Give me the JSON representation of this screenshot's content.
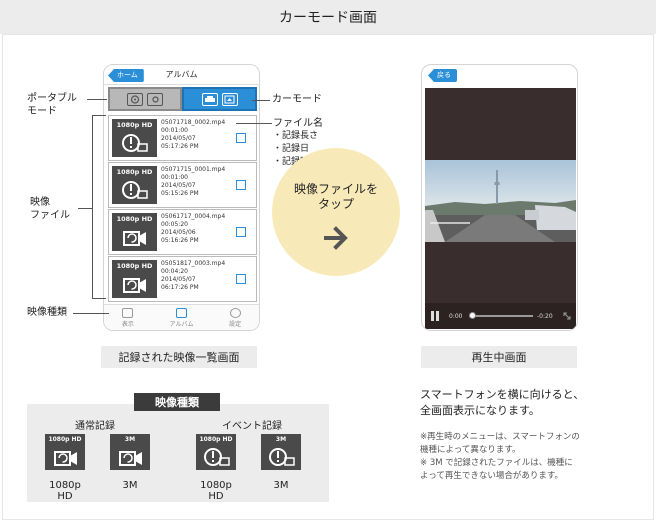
{
  "page_title": "カーモード画面",
  "album_screen": {
    "home_button": "ホーム",
    "title": "アルバム",
    "files": [
      {
        "badge": "1080p HD",
        "name": "05071718_0002.mp4",
        "duration": "00:01:00",
        "date": "2014/05/07",
        "time": "05:17:26 PM",
        "kind": "event"
      },
      {
        "badge": "1080p HD",
        "name": "05071715_0001.mp4",
        "duration": "00:01:00",
        "date": "2014/05/07",
        "time": "05:15:26 PM",
        "kind": "event"
      },
      {
        "badge": "1080p HD",
        "name": "05061717_0004.mp4",
        "duration": "00:05:20",
        "date": "2014/05/06",
        "time": "05:16:26 PM",
        "kind": "normal"
      },
      {
        "badge": "1080p HD",
        "name": "05051817_0003.mp4",
        "duration": "00:04:20",
        "date": "2014/05/07",
        "time": "06:17:26 PM",
        "kind": "normal"
      }
    ],
    "footer": [
      "表示",
      "アルバム",
      "設定"
    ]
  },
  "callouts": {
    "portable_mode": [
      "ポータブル",
      "モード"
    ],
    "car_mode": "カーモード",
    "file_name": "ファイル名",
    "file_details": [
      "・記録長さ",
      "・記録日",
      "・記録時間"
    ],
    "video_files": [
      "映像",
      "ファイル"
    ],
    "video_type": "映像種類"
  },
  "tap_hint": [
    "映像ファイルを",
    "タップ"
  ],
  "player_screen": {
    "back_button": "戻る",
    "time_start": "0:00",
    "time_end": "-0:20"
  },
  "captions": {
    "list_screen": "記録された映像一覧画面",
    "playback_screen": "再生中画面"
  },
  "legend": {
    "title": "映像種類",
    "normal_heading": "通常記録",
    "event_heading": "イベント記録",
    "items": [
      {
        "badge": "1080p HD",
        "caption": "1080p HD",
        "kind": "normal"
      },
      {
        "badge": "3M",
        "caption": "3M",
        "kind": "normal"
      },
      {
        "badge": "1080p HD",
        "caption": "1080p HD",
        "kind": "event"
      },
      {
        "badge": "3M",
        "caption": "3M",
        "kind": "event"
      }
    ]
  },
  "description": [
    "スマートフォンを横に向けると、",
    "全画面表示になります。"
  ],
  "notes": [
    "※再生時のメニューは、スマートフォンの",
    "機種によって異なります。",
    "※ 3M で記録されたファイルは、機種に",
    "よって再生できない場合があります。"
  ],
  "colors": {
    "accent": "#2a8fd6",
    "circle": "#f7eab8",
    "thumb": "#4a4a4a"
  }
}
